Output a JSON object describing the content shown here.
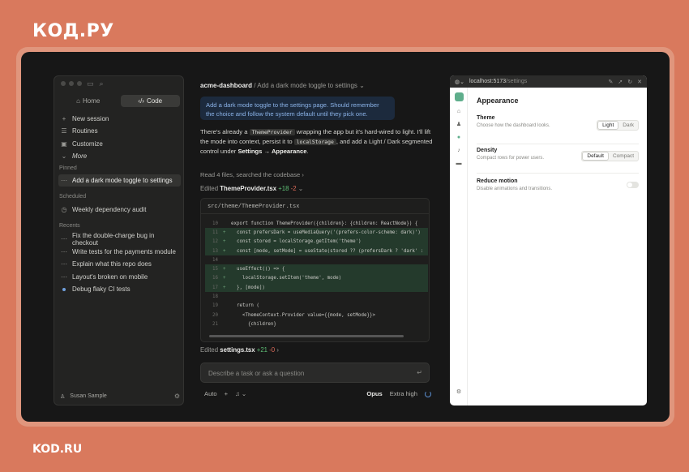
{
  "brand": {
    "top": "КОД.РУ",
    "bottom": "KOD.RU"
  },
  "sidebar": {
    "tabs": [
      {
        "label": "Home",
        "icon": "home-icon"
      },
      {
        "label": "Code",
        "icon": "code-icon"
      }
    ],
    "nav": [
      {
        "label": "New session",
        "icon": "plus-icon"
      },
      {
        "label": "Routines",
        "icon": "routines-icon"
      },
      {
        "label": "Customize",
        "icon": "box-icon"
      },
      {
        "label": "More",
        "icon": "chevron-down-icon"
      }
    ],
    "pinned_label": "Pinned",
    "pinned": [
      {
        "label": "Add a dark mode toggle to settings"
      }
    ],
    "scheduled_label": "Scheduled",
    "scheduled": [
      {
        "label": "Weekly dependency audit"
      }
    ],
    "recents_label": "Recents",
    "recents": [
      {
        "label": "Fix the double-charge bug in checkout"
      },
      {
        "label": "Write tests for the payments module"
      },
      {
        "label": "Explain what this repo does"
      },
      {
        "label": "Layout's broken on mobile"
      },
      {
        "label": "Debug flaky CI tests"
      }
    ],
    "user": "Susan Sample"
  },
  "main": {
    "repo": "acme-dashboard",
    "separator": "/",
    "title": "Add a dark mode toggle to settings",
    "user_message": "Add a dark mode toggle to the settings page. Should remember the choice and follow the system default until they pick one.",
    "reply": {
      "p1": "There's already a",
      "chip1": "ThemeProvider",
      "p2": "wrapping the app but it's hard-wired to light. I'll lift the mode into context, persist it to",
      "chip2": "localStorage",
      "p3": ", and add a Light / Dark segmented control under",
      "bold": "Settings → Appearance",
      "end": "."
    },
    "read_summary": "Read 4 files, searched the codebase",
    "edit1": {
      "prefix": "Edited",
      "file": "ThemeProvider.tsx",
      "add": "+18",
      "del": "-2"
    },
    "code_path": "src/theme/ThemeProvider.tsx",
    "code_lines": [
      {
        "num": "10",
        "mark": "",
        "text": "export function ThemeProvider({children}: {children: ReactNode}) {",
        "added": false
      },
      {
        "num": "11",
        "mark": "+",
        "text": "  const prefersDark = useMediaQuery('(prefers-color-scheme: dark)')",
        "added": true
      },
      {
        "num": "12",
        "mark": "+",
        "text": "  const stored = localStorage.getItem('theme')",
        "added": true
      },
      {
        "num": "13",
        "mark": "+",
        "text": "  const [mode, setMode] = useState(stored ?? (prefersDark ? 'dark' :",
        "added": true
      },
      {
        "num": "14",
        "mark": "",
        "text": "",
        "added": false
      },
      {
        "num": "15",
        "mark": "+",
        "text": "  useEffect(() => {",
        "added": true
      },
      {
        "num": "16",
        "mark": "+",
        "text": "    localStorage.setItem('theme', mode)",
        "added": true
      },
      {
        "num": "17",
        "mark": "+",
        "text": "  }, [mode])",
        "added": true
      },
      {
        "num": "18",
        "mark": "",
        "text": "",
        "added": false
      },
      {
        "num": "19",
        "mark": "",
        "text": "  return (",
        "added": false
      },
      {
        "num": "20",
        "mark": "",
        "text": "    <ThemeContext.Provider value={{mode, setMode}}>",
        "added": false
      },
      {
        "num": "21",
        "mark": "",
        "text": "      {children}",
        "added": false
      }
    ],
    "edit2": {
      "prefix": "Edited",
      "file": "settings.tsx",
      "add": "+21",
      "del": "-0"
    },
    "input_placeholder": "Describe a task or ask a question",
    "mode": "Auto",
    "model": "Opus",
    "effort": "Extra high"
  },
  "browser": {
    "url_host": "localhost:5173",
    "url_path": "/settings",
    "heading": "Appearance",
    "theme": {
      "title": "Theme",
      "desc": "Choose how the dashboard looks.",
      "options": [
        "Light",
        "Dark"
      ],
      "selected": "Light"
    },
    "density": {
      "title": "Density",
      "desc": "Compact rows for power users.",
      "options": [
        "Default",
        "Compact"
      ],
      "selected": "Default"
    },
    "motion": {
      "title": "Reduce motion",
      "desc": "Disable animations and transitions.",
      "enabled": false
    }
  }
}
